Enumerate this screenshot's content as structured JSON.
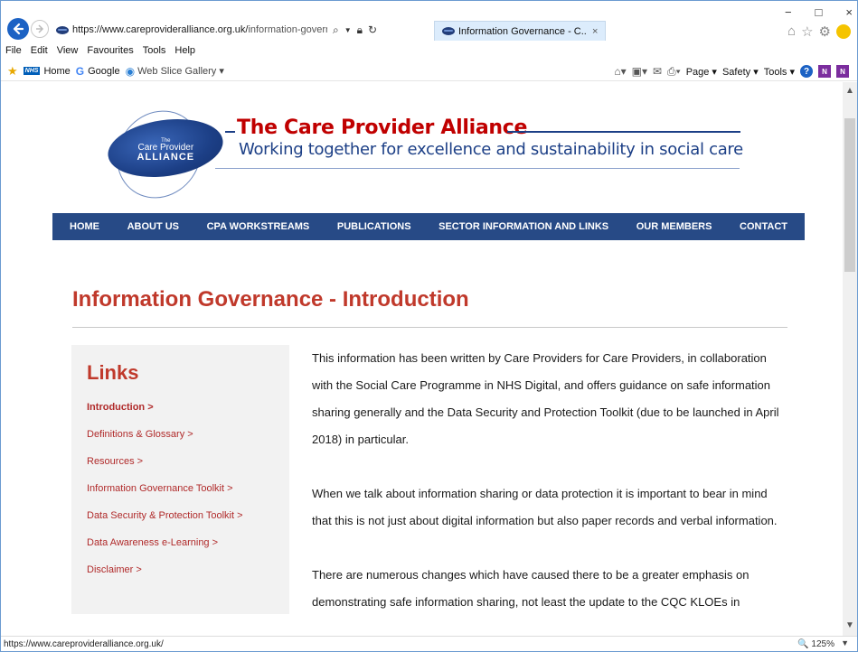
{
  "browser": {
    "url_main": "https://www.careprovideralliance.org.uk/",
    "url_rest": "information-governance.h",
    "tab_title": "Information Governance - C...",
    "tab_close": "×",
    "window_controls": {
      "minimize": "−",
      "maximize": "□",
      "close": "×"
    }
  },
  "menubar": [
    "File",
    "Edit",
    "View",
    "Favourites",
    "Tools",
    "Help"
  ],
  "favourites": {
    "nhs_badge": "NHS",
    "home": "Home",
    "google": "Google",
    "web_slice": "Web Slice Gallery ▾"
  },
  "command_bar": {
    "page": "Page ▾",
    "safety": "Safety ▾",
    "tools": "Tools ▾"
  },
  "site": {
    "logo": {
      "the": "The",
      "care_provider": "Care Provider",
      "alliance": "ALLIANCE"
    },
    "title": "The Care Provider Alliance",
    "tagline": "Working together for excellence and sustainability in social care",
    "nav": [
      "HOME",
      "ABOUT US",
      "CPA WORKSTREAMS",
      "PUBLICATIONS",
      "SECTOR INFORMATION AND LINKS",
      "OUR MEMBERS",
      "CONTACT"
    ]
  },
  "page": {
    "title": "Information Governance - Introduction",
    "links_heading": "Links",
    "links": [
      "Introduction >",
      "Definitions & Glossary >",
      "Resources >",
      "Information Governance Toolkit >",
      "Data Security & Protection Toolkit >",
      "Data Awareness e-Learning >",
      "Disclaimer >"
    ],
    "paragraphs": [
      "This information has been written by Care Providers for Care Providers, in collaboration with the Social Care Programme in NHS Digital, and offers guidance on safe information sharing generally and the Data Security and Protection Toolkit (due to be launched in April 2018) in particular.",
      "When we talk about information sharing or data protection it is important to bear in mind that this is not just about digital information but also paper records and verbal information.",
      "There are numerous changes which have caused there to be a greater emphasis on demonstrating safe information sharing, not least the update to the CQC KLOEs in"
    ]
  },
  "status": {
    "url": "https://www.careprovideralliance.org.uk/",
    "zoom": "🔍 125%",
    "zoom_dropdown": "▼"
  }
}
